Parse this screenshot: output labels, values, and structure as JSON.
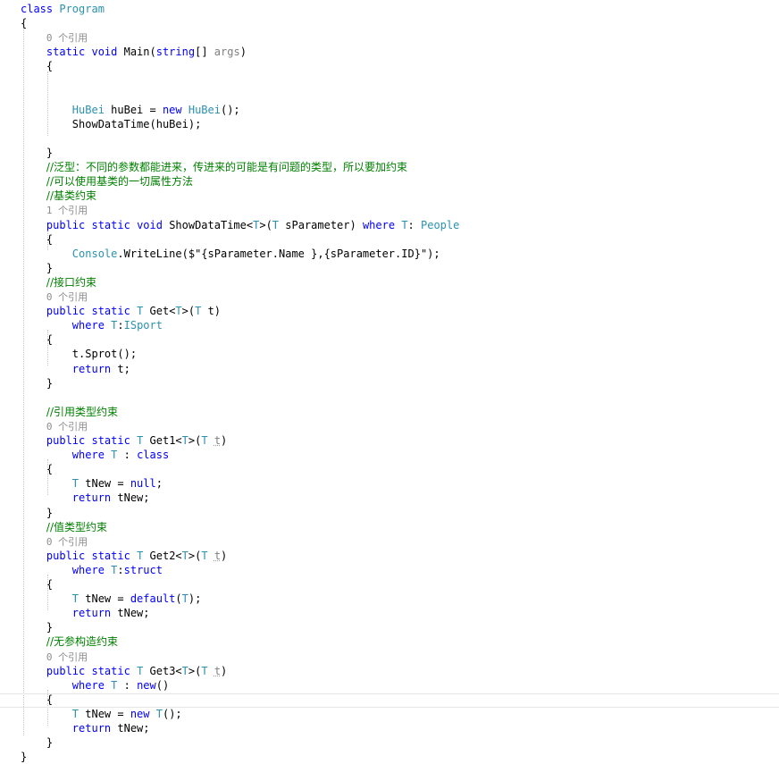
{
  "editor": {
    "lines": [
      [
        {
          "t": "class ",
          "c": "kw"
        },
        {
          "t": "Program",
          "c": "ty"
        }
      ],
      [
        {
          "t": "{"
        }
      ],
      [
        {
          "t": "    "
        },
        {
          "t": "0 个引用",
          "c": "ref"
        }
      ],
      [
        {
          "t": "    "
        },
        {
          "t": "static ",
          "c": "kw"
        },
        {
          "t": "void ",
          "c": "kw"
        },
        {
          "t": "Main("
        },
        {
          "t": "string",
          "c": "kw"
        },
        {
          "t": "[] "
        },
        {
          "t": "args",
          "c": "pn"
        },
        {
          "t": ")"
        }
      ],
      [
        {
          "t": "    {"
        }
      ],
      [
        {
          "t": ""
        }
      ],
      [
        {
          "t": ""
        }
      ],
      [
        {
          "t": "        "
        },
        {
          "t": "HuBei",
          "c": "ty"
        },
        {
          "t": " huBei = "
        },
        {
          "t": "new ",
          "c": "kw"
        },
        {
          "t": "HuBei",
          "c": "ty"
        },
        {
          "t": "();"
        }
      ],
      [
        {
          "t": "        ShowDataTime(huBei);"
        }
      ],
      [
        {
          "t": ""
        }
      ],
      [
        {
          "t": "    }"
        }
      ],
      [
        {
          "t": "    "
        },
        {
          "t": "//泛型：不同的参数都能进来，传进来的可能是有问题的类型，所以要加约束",
          "c": "cm"
        }
      ],
      [
        {
          "t": "    "
        },
        {
          "t": "//可以使用基类的一切属性方法",
          "c": "cm"
        }
      ],
      [
        {
          "t": "    "
        },
        {
          "t": "//基类约束",
          "c": "cm"
        }
      ],
      [
        {
          "t": "    "
        },
        {
          "t": "1 个引用",
          "c": "ref"
        }
      ],
      [
        {
          "t": "    "
        },
        {
          "t": "public ",
          "c": "kw"
        },
        {
          "t": "static ",
          "c": "kw"
        },
        {
          "t": "void ",
          "c": "kw"
        },
        {
          "t": "ShowDataTime<"
        },
        {
          "t": "T",
          "c": "ty"
        },
        {
          "t": ">("
        },
        {
          "t": "T",
          "c": "ty"
        },
        {
          "t": " sParameter) "
        },
        {
          "t": "where ",
          "c": "kw"
        },
        {
          "t": "T",
          "c": "ty"
        },
        {
          "t": ": "
        },
        {
          "t": "People",
          "c": "ty"
        }
      ],
      [
        {
          "t": "    {"
        }
      ],
      [
        {
          "t": "        "
        },
        {
          "t": "Console",
          "c": "ty"
        },
        {
          "t": ".WriteLine($\""
        },
        {
          "t": "{sParameter.Name },{sParameter.ID}"
        },
        {
          "t": "\");"
        }
      ],
      [
        {
          "t": "    }"
        }
      ],
      [
        {
          "t": "    "
        },
        {
          "t": "//接口约束",
          "c": "cm"
        }
      ],
      [
        {
          "t": "    "
        },
        {
          "t": "0 个引用",
          "c": "ref"
        }
      ],
      [
        {
          "t": "    "
        },
        {
          "t": "public ",
          "c": "kw"
        },
        {
          "t": "static ",
          "c": "kw"
        },
        {
          "t": "T",
          "c": "ty"
        },
        {
          "t": " Get<"
        },
        {
          "t": "T",
          "c": "ty"
        },
        {
          "t": ">("
        },
        {
          "t": "T",
          "c": "ty"
        },
        {
          "t": " t)"
        }
      ],
      [
        {
          "t": "        "
        },
        {
          "t": "where ",
          "c": "kw"
        },
        {
          "t": "T",
          "c": "ty"
        },
        {
          "t": ":"
        },
        {
          "t": "ISport",
          "c": "ty"
        }
      ],
      [
        {
          "t": "    {"
        }
      ],
      [
        {
          "t": "        t.Sprot();"
        }
      ],
      [
        {
          "t": "        "
        },
        {
          "t": "return ",
          "c": "kw"
        },
        {
          "t": "t;"
        }
      ],
      [
        {
          "t": "    }"
        }
      ],
      [
        {
          "t": ""
        }
      ],
      [
        {
          "t": "    "
        },
        {
          "t": "//引用类型约束",
          "c": "cm"
        }
      ],
      [
        {
          "t": "    "
        },
        {
          "t": "0 个引用",
          "c": "ref"
        }
      ],
      [
        {
          "t": "    "
        },
        {
          "t": "public ",
          "c": "kw"
        },
        {
          "t": "static ",
          "c": "kw"
        },
        {
          "t": "T",
          "c": "ty"
        },
        {
          "t": " Get1<"
        },
        {
          "t": "T",
          "c": "ty"
        },
        {
          "t": ">("
        },
        {
          "t": "T",
          "c": "ty"
        },
        {
          "t": " "
        },
        {
          "t": "t",
          "c": "pn"
        },
        {
          "t": ")"
        }
      ],
      [
        {
          "t": "        "
        },
        {
          "t": "where ",
          "c": "kw"
        },
        {
          "t": "T",
          "c": "ty"
        },
        {
          "t": " : "
        },
        {
          "t": "class",
          "c": "kw"
        }
      ],
      [
        {
          "t": "    {"
        }
      ],
      [
        {
          "t": "        "
        },
        {
          "t": "T",
          "c": "ty"
        },
        {
          "t": " tNew = "
        },
        {
          "t": "null",
          "c": "kw"
        },
        {
          "t": ";"
        }
      ],
      [
        {
          "t": "        "
        },
        {
          "t": "return ",
          "c": "kw"
        },
        {
          "t": "tNew;"
        }
      ],
      [
        {
          "t": "    }"
        }
      ],
      [
        {
          "t": "    "
        },
        {
          "t": "//值类型约束",
          "c": "cm"
        }
      ],
      [
        {
          "t": "    "
        },
        {
          "t": "0 个引用",
          "c": "ref"
        }
      ],
      [
        {
          "t": "    "
        },
        {
          "t": "public ",
          "c": "kw"
        },
        {
          "t": "static ",
          "c": "kw"
        },
        {
          "t": "T",
          "c": "ty"
        },
        {
          "t": " Get2<"
        },
        {
          "t": "T",
          "c": "ty"
        },
        {
          "t": ">("
        },
        {
          "t": "T",
          "c": "ty"
        },
        {
          "t": " "
        },
        {
          "t": "t",
          "c": "pn"
        },
        {
          "t": ")"
        }
      ],
      [
        {
          "t": "        "
        },
        {
          "t": "where ",
          "c": "kw"
        },
        {
          "t": "T",
          "c": "ty"
        },
        {
          "t": ":"
        },
        {
          "t": "struct",
          "c": "kw"
        }
      ],
      [
        {
          "t": "    {"
        }
      ],
      [
        {
          "t": "        "
        },
        {
          "t": "T",
          "c": "ty"
        },
        {
          "t": " tNew = "
        },
        {
          "t": "default",
          "c": "kw"
        },
        {
          "t": "("
        },
        {
          "t": "T",
          "c": "ty"
        },
        {
          "t": ");"
        }
      ],
      [
        {
          "t": "        "
        },
        {
          "t": "return ",
          "c": "kw"
        },
        {
          "t": "tNew;"
        }
      ],
      [
        {
          "t": "    }"
        }
      ],
      [
        {
          "t": "    "
        },
        {
          "t": "//无参构造约束",
          "c": "cm"
        }
      ],
      [
        {
          "t": "    "
        },
        {
          "t": "0 个引用",
          "c": "ref"
        }
      ],
      [
        {
          "t": "    "
        },
        {
          "t": "public ",
          "c": "kw"
        },
        {
          "t": "static ",
          "c": "kw"
        },
        {
          "t": "T",
          "c": "ty"
        },
        {
          "t": " Get3<"
        },
        {
          "t": "T",
          "c": "ty"
        },
        {
          "t": ">("
        },
        {
          "t": "T",
          "c": "ty"
        },
        {
          "t": " "
        },
        {
          "t": "t",
          "c": "pn"
        },
        {
          "t": ")"
        }
      ],
      [
        {
          "t": "        "
        },
        {
          "t": "where ",
          "c": "kw"
        },
        {
          "t": "T",
          "c": "ty"
        },
        {
          "t": " : "
        },
        {
          "t": "new",
          "c": "kw"
        },
        {
          "t": "()"
        }
      ],
      [
        {
          "t": "    {"
        }
      ],
      [
        {
          "t": "        "
        },
        {
          "t": "T",
          "c": "ty"
        },
        {
          "t": " tNew = "
        },
        {
          "t": "new ",
          "c": "kw"
        },
        {
          "t": "T",
          "c": "ty"
        },
        {
          "t": "();"
        }
      ],
      [
        {
          "t": "        "
        },
        {
          "t": "return ",
          "c": "kw"
        },
        {
          "t": "tNew;"
        }
      ],
      [
        {
          "t": "    }"
        }
      ],
      [
        {
          "t": "}"
        }
      ]
    ],
    "colors": {
      "keyword": "#0000ff",
      "type": "#2b91af",
      "comment": "#008000",
      "codelens": "#8c8c8c",
      "unused_param": "#808080"
    }
  }
}
